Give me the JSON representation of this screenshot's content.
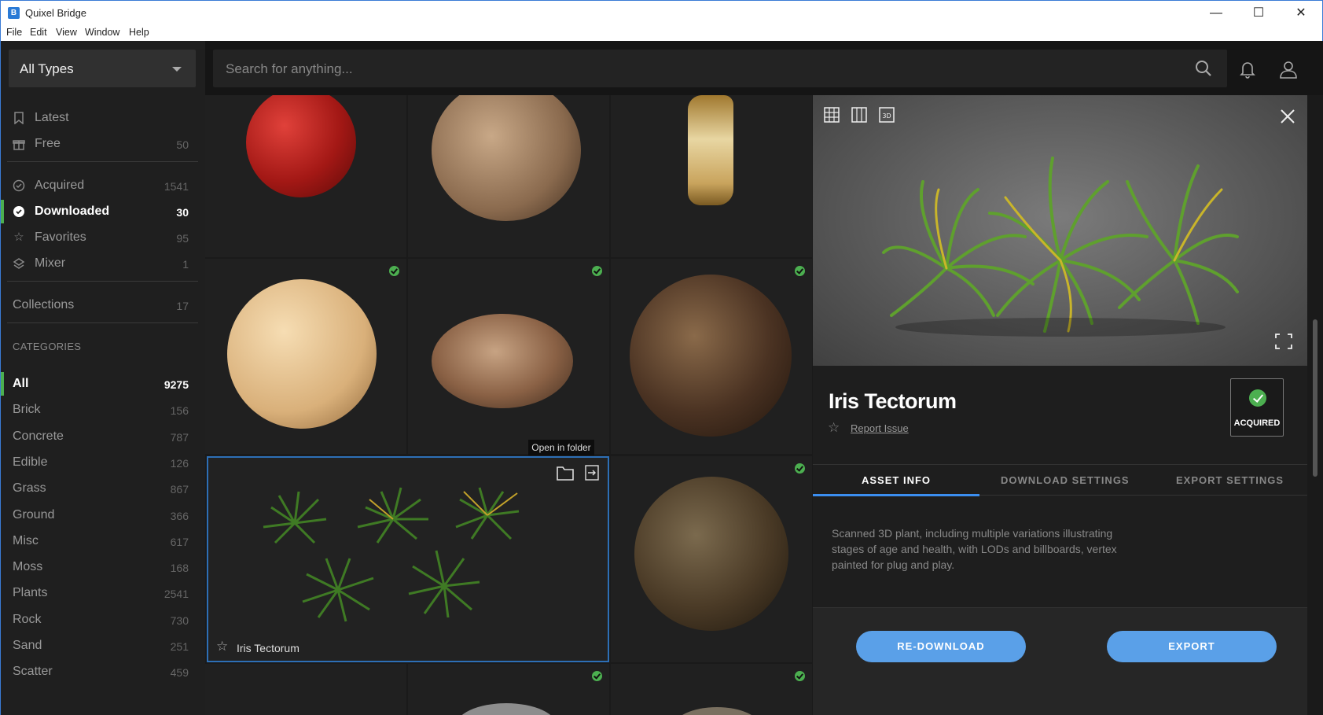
{
  "window": {
    "title": "Quixel Bridge",
    "minimize": "—",
    "maximize": "☐",
    "close": "✕"
  },
  "menu": [
    "File",
    "Edit",
    "View",
    "Window",
    "Help"
  ],
  "type_select": {
    "label": "All Types"
  },
  "search": {
    "placeholder": "Search for anything..."
  },
  "nav": [
    {
      "label": "Latest",
      "count": "",
      "icon": "bookmark-icon"
    },
    {
      "label": "Free",
      "count": "50",
      "icon": "gift-icon"
    },
    {
      "label": "Acquired",
      "count": "1541",
      "icon": "check-circle-icon"
    },
    {
      "label": "Downloaded",
      "count": "30",
      "icon": "check-filled-icon"
    },
    {
      "label": "Favorites",
      "count": "95",
      "icon": "star-icon"
    },
    {
      "label": "Mixer",
      "count": "1",
      "icon": "layers-icon"
    }
  ],
  "collections": {
    "label": "Collections",
    "count": "17"
  },
  "categories_heading": "CATEGORIES",
  "categories": [
    {
      "label": "All",
      "count": "9275"
    },
    {
      "label": "Brick",
      "count": "156"
    },
    {
      "label": "Concrete",
      "count": "787"
    },
    {
      "label": "Edible",
      "count": "126"
    },
    {
      "label": "Grass",
      "count": "867"
    },
    {
      "label": "Ground",
      "count": "366"
    },
    {
      "label": "Misc",
      "count": "617"
    },
    {
      "label": "Moss",
      "count": "168"
    },
    {
      "label": "Plants",
      "count": "2541"
    },
    {
      "label": "Rock",
      "count": "730"
    },
    {
      "label": "Sand",
      "count": "251"
    },
    {
      "label": "Scatter",
      "count": "459"
    }
  ],
  "grid": {
    "selected_name": "Iris Tectorum",
    "tooltip": "Open in folder"
  },
  "detail": {
    "title": "Iris Tectorum",
    "report_link": "Report Issue",
    "badge": "ACQUIRED",
    "tabs": [
      "ASSET INFO",
      "DOWNLOAD SETTINGS",
      "EXPORT SETTINGS"
    ],
    "description": "Scanned 3D plant, including multiple variations illustrating stages of age and health, with LODs and billboards, vertex painted for plug and play.",
    "redownload": "RE-DOWNLOAD",
    "export": "EXPORT"
  },
  "colors": {
    "accent_green": "#4caf50",
    "accent_blue": "#5aa0e8",
    "selection": "#2d6fb6"
  }
}
